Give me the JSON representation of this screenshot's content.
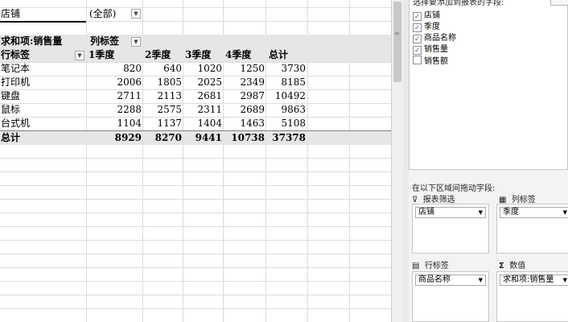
{
  "filter": {
    "field": "店铺",
    "value": "(全部)"
  },
  "pivot": {
    "value_label": "求和项:销售量",
    "col_label": "列标签",
    "row_label": "行标签",
    "columns": [
      "1季度",
      "2季度",
      "3季度",
      "4季度",
      "总计"
    ],
    "rows": [
      {
        "name": "笔记本",
        "values": [
          "820",
          "640",
          "1020",
          "1250",
          "3730"
        ]
      },
      {
        "name": "打印机",
        "values": [
          "2006",
          "1805",
          "2025",
          "2349",
          "8185"
        ]
      },
      {
        "name": "键盘",
        "values": [
          "2711",
          "2113",
          "2681",
          "2987",
          "10492"
        ]
      },
      {
        "name": "鼠标",
        "values": [
          "2288",
          "2575",
          "2311",
          "2689",
          "9863"
        ]
      },
      {
        "name": "台式机",
        "values": [
          "1104",
          "1137",
          "1404",
          "1463",
          "5108"
        ]
      }
    ],
    "total": {
      "name": "总计",
      "values": [
        "8929",
        "8270",
        "9441",
        "10738",
        "37378"
      ]
    }
  },
  "field_list": {
    "header": "选择要添加到报表的字段:",
    "fields": [
      {
        "name": "店铺",
        "checked": true
      },
      {
        "name": "季度",
        "checked": true
      },
      {
        "name": "商品名称",
        "checked": true
      },
      {
        "name": "销售量",
        "checked": true
      },
      {
        "name": "销售额",
        "checked": false
      }
    ],
    "drag_hint": "在以下区域间拖动字段:",
    "areas": {
      "filter": {
        "title": "报表筛选",
        "item": "店铺",
        "icon": "filter-icon"
      },
      "columns": {
        "title": "列标签",
        "item": "季度",
        "icon": "columns-icon"
      },
      "rows": {
        "title": "行标签",
        "item": "商品名称",
        "icon": "rows-icon"
      },
      "values": {
        "title": "数值",
        "item": "求和项:销售量",
        "icon": "sigma-icon"
      }
    }
  }
}
